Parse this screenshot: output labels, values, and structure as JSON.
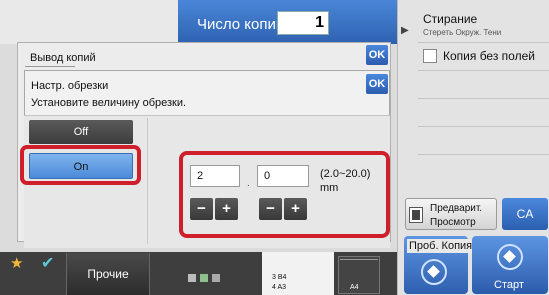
{
  "header": {
    "copies_label": "Число копий",
    "copies_value": "1"
  },
  "right_panel": {
    "erase_title": "Стирание",
    "erase_subtitle": "Стереть Окруж. Тени",
    "borderless_label": "Копия без полей",
    "preview_line1": "Предварит.",
    "preview_line2": "Просмотр",
    "ca_label": "CA",
    "trial_label": "Проб. Копия",
    "start_label": "Старт"
  },
  "output_dialog": {
    "title": "Вывод копий",
    "ok_label": "OK"
  },
  "trim_dialog": {
    "title": "Настр. обрезки",
    "subtitle": "Установите величину обрезки.",
    "ok_label": "OK",
    "off_label": "Off",
    "on_label": "On",
    "selected": "On",
    "value1": "2",
    "value2": "0",
    "dot": ".",
    "range": "(2.0~20.0)",
    "unit": "mm",
    "minus": "−",
    "plus": "+"
  },
  "bottom_bar": {
    "other_label": "Прочие",
    "paper_line1": "3     B4",
    "paper_line2": "4     A3",
    "paper_size": "A4",
    "star_icon": "star-icon",
    "check_icon": "check-icon"
  },
  "colors": {
    "accent_blue": "#2e62b0",
    "highlight_red": "#cf1f2b",
    "selected_blue": "#7fb4ee"
  }
}
